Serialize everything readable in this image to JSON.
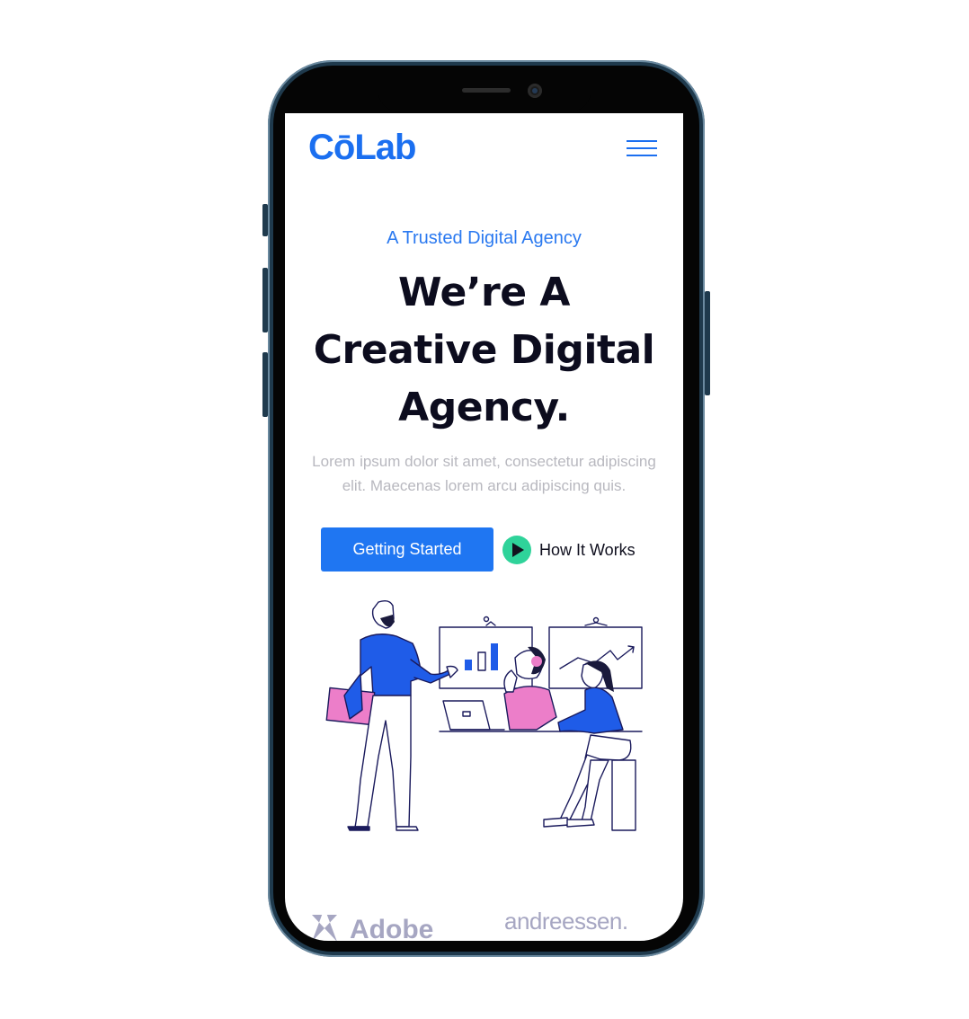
{
  "brand": {
    "logo_text": "CōLab",
    "accent_color": "#1b6ff0",
    "cta_color": "#1f76f2",
    "play_color": "#2fd39a"
  },
  "header": {
    "menu_icon": "hamburger-menu-icon"
  },
  "hero": {
    "eyebrow": "A Trusted Digital Agency",
    "headline_lines": [
      "We’re A",
      "Creative Digital",
      "Agency."
    ],
    "lead": "Lorem ipsum dolor sit amet, consectetur adipiscing elit. Maecenas lorem arcu adipiscing quis.",
    "primary_cta": "Getting Started",
    "secondary_cta": "How It Works",
    "secondary_icon": "play-icon"
  },
  "illustration": {
    "chart_bars": [
      2,
      3,
      4
    ]
  },
  "partners": {
    "items": [
      "Adobe",
      "andreessen."
    ]
  }
}
